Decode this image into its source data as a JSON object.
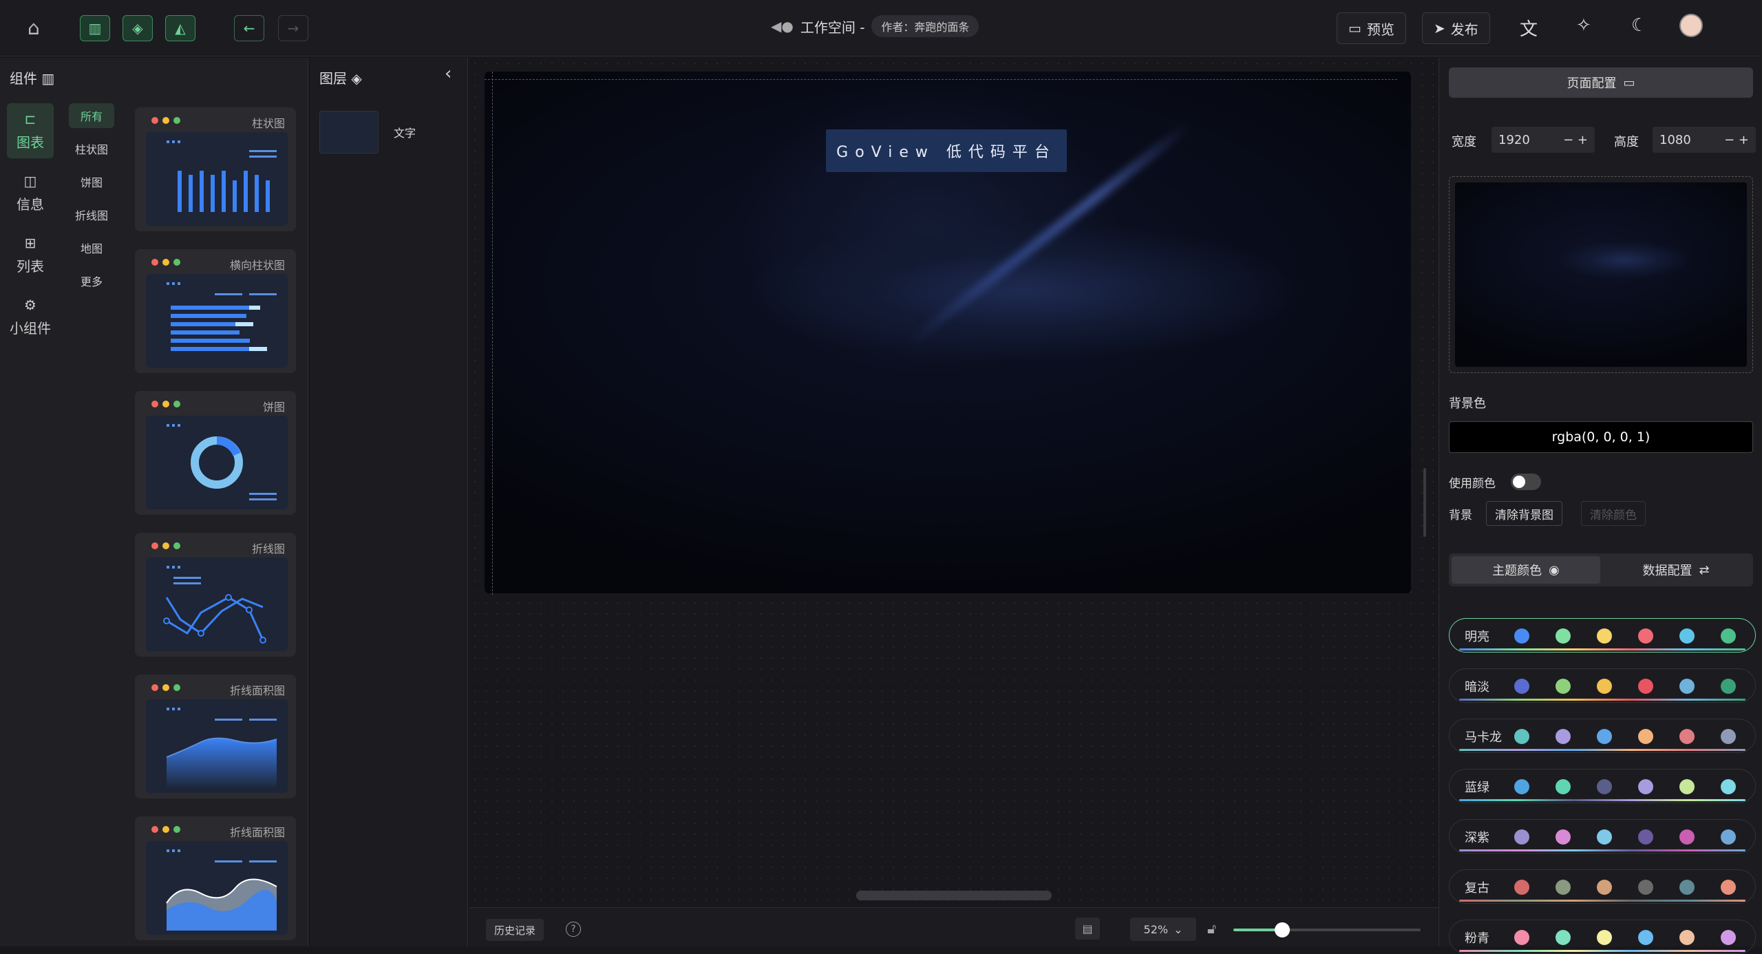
{
  "topbar": {
    "title": "工作空间 -",
    "author": "作者：奔跑的面条",
    "preview": "预览",
    "publish": "发布"
  },
  "components": {
    "header": "组件",
    "categories": [
      {
        "label": "图表",
        "icon": "chart-icon"
      },
      {
        "label": "信息",
        "icon": "info-icon"
      },
      {
        "label": "列表",
        "icon": "table-icon"
      },
      {
        "label": "小组件",
        "icon": "widget-icon"
      }
    ],
    "subcategories": [
      "所有",
      "柱状图",
      "饼图",
      "折线图",
      "地图",
      "更多"
    ],
    "cards": [
      "柱状图",
      "横向柱状图",
      "饼图",
      "折线图",
      "折线面积图",
      "折线面积图"
    ]
  },
  "layers": {
    "header": "图层",
    "items": [
      {
        "label": "文字"
      }
    ]
  },
  "canvas": {
    "banner": "GoView 低代码平台"
  },
  "bottombar": {
    "history": "历史记录",
    "zoom": "52%",
    "zoom_level_percent": 52
  },
  "right": {
    "page_config": "页面配置",
    "width_label": "宽度",
    "width": "1920",
    "height_label": "高度",
    "height": "1080",
    "bg_color_label": "背景色",
    "bg_color": "rgba(0, 0, 0, 1)",
    "use_color_label": "使用颜色",
    "bg_label": "背景",
    "clear_bg_image": "清除背景图",
    "clear_color": "清除颜色",
    "tab_theme": "主题颜色",
    "tab_data": "数据配置",
    "themes": [
      {
        "name": "明亮",
        "colors": [
          "#4a8af4",
          "#7fe0a2",
          "#f7d368",
          "#f06b76",
          "#5fc5e8",
          "#4cbf8a"
        ]
      },
      {
        "name": "暗淡",
        "colors": [
          "#5a6cd1",
          "#8fd07a",
          "#f2c04e",
          "#e85560",
          "#6fb2db",
          "#3aa07a"
        ]
      },
      {
        "name": "马卡龙",
        "colors": [
          "#5fc3c0",
          "#a99be0",
          "#5ea6e8",
          "#f2b27a",
          "#e07d82",
          "#8e9bb8"
        ]
      },
      {
        "name": "蓝绿",
        "colors": [
          "#4fa5e0",
          "#5fd6b0",
          "#5a5e8a",
          "#a99be0",
          "#c7e89a",
          "#7ed8e6"
        ]
      },
      {
        "name": "深紫",
        "colors": [
          "#9b8fd0",
          "#d88ad6",
          "#7ec9e8",
          "#6b5aa0",
          "#c95fb0",
          "#6fa8d8"
        ]
      },
      {
        "name": "复古",
        "colors": [
          "#d46a6a",
          "#8a9a80",
          "#d4a07a",
          "#6a6a6a",
          "#5f8a96",
          "#e8907a"
        ]
      },
      {
        "name": "粉青",
        "colors": [
          "#f28ca8",
          "#7fe0bf",
          "#f5f0a0",
          "#6bbcf0",
          "#f0c0a0",
          "#d09ae8"
        ]
      }
    ]
  }
}
